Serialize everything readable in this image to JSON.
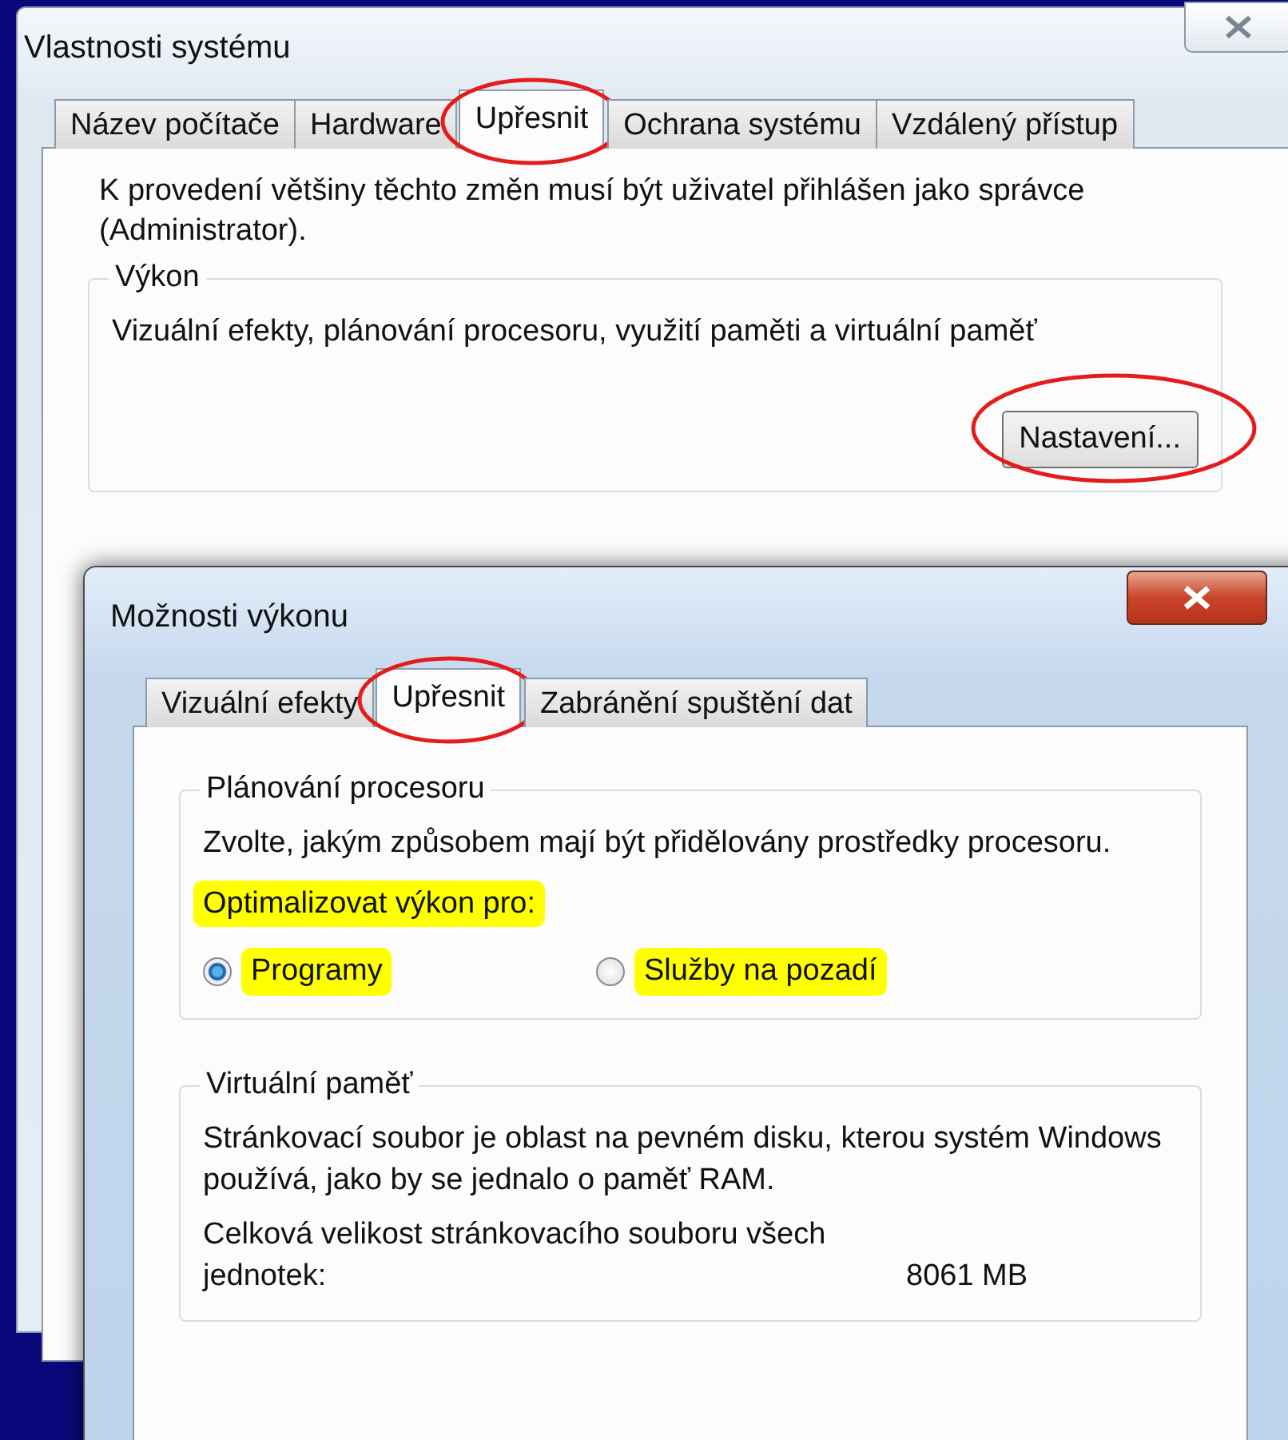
{
  "back_window": {
    "title": "Vlastnosti systému",
    "tabs": [
      {
        "label": "Název počítače",
        "selected": false,
        "circled": false
      },
      {
        "label": "Hardware",
        "selected": false,
        "circled": false
      },
      {
        "label": "Upřesnit",
        "selected": true,
        "circled": true
      },
      {
        "label": "Ochrana systému",
        "selected": false,
        "circled": false
      },
      {
        "label": "Vzdálený přístup",
        "selected": false,
        "circled": false
      }
    ],
    "intro": "K provedení většiny těchto změn musí být uživatel přihlášen jako správce (Administrator).",
    "performance_group": {
      "title": "Výkon",
      "description": "Vizuální efekty, plánování procesoru, využití paměti a virtuální paměť",
      "button": {
        "label": "Nastavení...",
        "circled": true
      }
    }
  },
  "front_window": {
    "title": "Možnosti výkonu",
    "tabs": [
      {
        "label": "Vizuální efekty",
        "selected": false,
        "circled": false
      },
      {
        "label": "Upřesnit",
        "selected": true,
        "circled": true
      },
      {
        "label": "Zabránění spuštění dat",
        "selected": false,
        "circled": false
      }
    ],
    "processor_group": {
      "title": "Plánování procesoru",
      "description": "Zvolte, jakým způsobem mají být přidělovány prostředky procesoru.",
      "prompt": {
        "text": "Optimalizovat výkon pro:",
        "highlighted": true
      },
      "options": [
        {
          "label": "Programy",
          "selected": true,
          "highlighted": true
        },
        {
          "label": "Služby na pozadí",
          "selected": false,
          "highlighted": true
        }
      ]
    },
    "virtual_memory_group": {
      "title": "Virtuální paměť",
      "description": "Stránkovací soubor je oblast na pevném disku, kterou systém Windows používá, jako by se jednalo o paměť RAM.",
      "total_label": "Celková velikost stránkovacího souboru všech jednotek:",
      "total_value": "8061 MB"
    }
  }
}
